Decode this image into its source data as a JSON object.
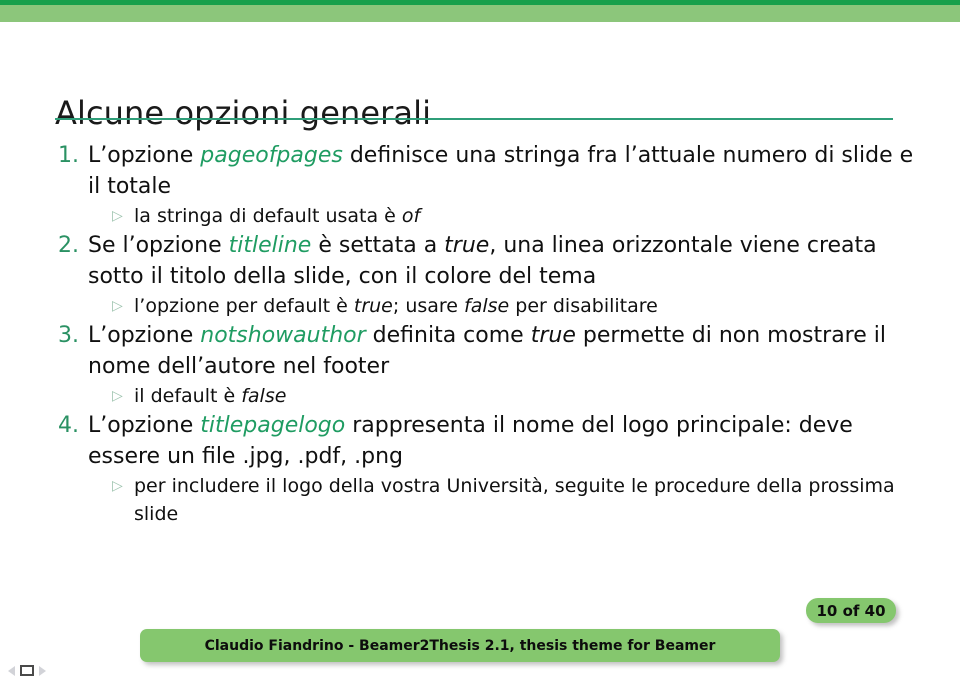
{
  "theme": {
    "accent_dark_green": "#18a04b",
    "accent_light_green": "#8cc67b",
    "rule_green": "#2f9e79",
    "keyword_green": "#1f9c62",
    "number_green": "#2a9163",
    "badge_green": "#85c76e",
    "text_black": "#101010"
  },
  "title": "Alcune opzioni generali",
  "list": [
    {
      "number": "1.",
      "segments": [
        {
          "text": "L’opzione ",
          "style": "normal"
        },
        {
          "text": "pageofpages",
          "style": "keyword"
        },
        {
          "text": " definisce una stringa fra l’attuale numero di slide e il totale",
          "style": "normal"
        }
      ],
      "plain": "L’opzione pageofpages definisce una stringa fra l’attuale numero di slide e il totale",
      "sub": [
        {
          "marker": "▷",
          "segments": [
            {
              "text": "la stringa di default usata è ",
              "style": "normal"
            },
            {
              "text": "of",
              "style": "emph"
            }
          ],
          "plain": "la stringa di default usata è of"
        }
      ]
    },
    {
      "number": "2.",
      "segments": [
        {
          "text": "Se l’opzione ",
          "style": "normal"
        },
        {
          "text": "titleline",
          "style": "keyword"
        },
        {
          "text": " è settata a ",
          "style": "normal"
        },
        {
          "text": "true",
          "style": "emph"
        },
        {
          "text": ", una linea orizzontale viene creata sotto il titolo della slide, con il colore del tema",
          "style": "normal"
        }
      ],
      "plain": "Se l’opzione titleline è settata a true, una linea orizzontale viene creata sotto il titolo della slide, con il colore del tema",
      "sub": [
        {
          "marker": "▷",
          "segments": [
            {
              "text": "l’opzione per default è ",
              "style": "normal"
            },
            {
              "text": "true",
              "style": "emph"
            },
            {
              "text": "; usare ",
              "style": "normal"
            },
            {
              "text": "false",
              "style": "emph"
            },
            {
              "text": " per disabilitare",
              "style": "normal"
            }
          ],
          "plain": "l’opzione per default è true; usare false per disabilitare"
        }
      ]
    },
    {
      "number": "3.",
      "segments": [
        {
          "text": "L’opzione ",
          "style": "normal"
        },
        {
          "text": "notshowauthor",
          "style": "keyword"
        },
        {
          "text": " definita come ",
          "style": "normal"
        },
        {
          "text": "true",
          "style": "emph"
        },
        {
          "text": " permette di non mostrare il nome dell’autore nel footer",
          "style": "normal"
        }
      ],
      "plain": "L’opzione notshowauthor definita come true permette di non mostrare il nome dell’autore nel footer",
      "sub": [
        {
          "marker": "▷",
          "segments": [
            {
              "text": "il default è ",
              "style": "normal"
            },
            {
              "text": "false",
              "style": "emph"
            }
          ],
          "plain": "il default è false"
        }
      ]
    },
    {
      "number": "4.",
      "segments": [
        {
          "text": "L’opzione ",
          "style": "normal"
        },
        {
          "text": "titlepagelogo",
          "style": "keyword"
        },
        {
          "text": " rappresenta il nome del logo principale: deve essere un file .jpg, .pdf, .png",
          "style": "normal"
        }
      ],
      "plain": "L’opzione titlepagelogo rappresenta il nome del logo principale: deve essere un file .jpg, .pdf, .png",
      "sub": [
        {
          "marker": "▷",
          "segments": [
            {
              "text": "per includere il logo della vostra Università, seguite le procedure della prossima slide",
              "style": "normal"
            }
          ],
          "plain": "per includere il logo della vostra Università, seguite le procedure della prossima slide"
        }
      ]
    }
  ],
  "footer": {
    "page_indicator": "10 of 40",
    "author_line": "Claudio Fiandrino - Beamer2Thesis 2.1, thesis theme for Beamer"
  },
  "nav": {
    "prev_icon": "triangle-left-icon",
    "frame_icon": "frame-icon",
    "next_icon": "triangle-right-icon"
  }
}
